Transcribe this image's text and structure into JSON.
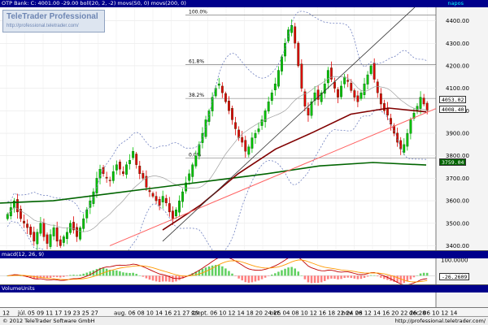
{
  "main_panel": {
    "header": "OTP Bank: C: 4001.00 -29.00 boll(20, 2, -2) movs(50, 0) movs(200, 0)",
    "period": "napos",
    "y_ticks": [
      "4400.00",
      "4300.00",
      "4200.00",
      "4100.00",
      "4000.00",
      "3900.00",
      "3800.00",
      "3700.00",
      "3600.00",
      "3500.00",
      "3400.00"
    ],
    "fib_levels": [
      "100.0%",
      "61.8%",
      "38.2%",
      "0.0%"
    ],
    "tags": {
      "upper_band": "4053.02",
      "close": "4008.40",
      "ma200": "3759.04"
    }
  },
  "macd_panel": {
    "header": "macd(12, 26, 9)",
    "y_ticks": [
      "100.0000",
      "0.0000"
    ],
    "tag": "-26.2609"
  },
  "volume_panel": {
    "header": "VolumeUnits"
  },
  "logo": {
    "title": "TeleTrader Professional",
    "url": "http://professional.teletrader.com/"
  },
  "x_axis": {
    "labels": [
      "12",
      "júl.",
      "05 09 11 17 19 23 25 27",
      "aug. 06 08 10 14 16 21 27 29",
      "szept. 06 10 12 14 18 20 24 26",
      "okt. 04 08 10 12 16 18 22 24 26",
      "nov. 08 12 14 16 20 22 26 28",
      "dec. 06 10 12 14"
    ]
  },
  "footer": {
    "copyright": "© 2012 TeleTrader Software GmbH",
    "url": "http://professional.teletrader.com/"
  },
  "colors": {
    "header_bg": "#00008b",
    "candle_up": "#00c000",
    "candle_down": "#e00000",
    "ma50": "#800000",
    "ma200": "#006400",
    "bollinger": "#7080c0",
    "trendline_red": "#ff6060"
  },
  "chart_data": {
    "type": "candlestick",
    "title": "OTP Bank: C: 4001.00 -29.00 boll(20, 2, -2) movs(50, 0) movs(200, 0)",
    "ylim": [
      3380,
      4460
    ],
    "y_ticks": [
      3400,
      3500,
      3600,
      3700,
      3800,
      3900,
      4000,
      4100,
      4200,
      4300,
      4400
    ],
    "closes": [
      3540,
      3570,
      3600,
      3550,
      3520,
      3500,
      3480,
      3450,
      3420,
      3460,
      3500,
      3440,
      3410,
      3450,
      3480,
      3420,
      3400,
      3440,
      3460,
      3500,
      3470,
      3440,
      3480,
      3520,
      3560,
      3600,
      3640,
      3700,
      3740,
      3720,
      3700,
      3690,
      3730,
      3760,
      3740,
      3720,
      3760,
      3780,
      3820,
      3760,
      3720,
      3700,
      3660,
      3640,
      3620,
      3600,
      3580,
      3620,
      3590,
      3550,
      3520,
      3560,
      3600,
      3640,
      3680,
      3720,
      3760,
      3800,
      3850,
      3900,
      3960,
      4000,
      4060,
      4100,
      4120,
      4080,
      4040,
      4000,
      3960,
      3920,
      3880,
      3860,
      3820,
      3840,
      3880,
      3900,
      3920,
      3960,
      4000,
      4040,
      4080,
      4120,
      4180,
      4240,
      4300,
      4360,
      4380,
      4300,
      4200,
      4100,
      4020,
      3980,
      4040,
      4080,
      4050,
      4080,
      4120,
      4180,
      4140,
      4100,
      4060,
      4110,
      4150,
      4130,
      4090,
      4060,
      4040,
      4080,
      4120,
      4160,
      4200,
      4140,
      4080,
      4030,
      4000,
      3980,
      3940,
      3900,
      3860,
      3830,
      3850,
      3900,
      3960,
      3990,
      4020,
      4060,
      4030,
      4001
    ],
    "ma50": [
      3470,
      3580,
      3720,
      3830,
      3905,
      3985,
      4012,
      3995
    ],
    "ma200": [
      3590,
      3600,
      3630,
      3660,
      3690,
      3720,
      3755,
      3770,
      3759
    ],
    "fibonacci": {
      "0.0%": 3790,
      "38.2%": 4055,
      "61.8%": 4205,
      "100.0%": 4425
    },
    "macd_ylim": [
      -60,
      110
    ],
    "macd_ticks": [
      100,
      0
    ],
    "macd_last": -26.2609
  }
}
